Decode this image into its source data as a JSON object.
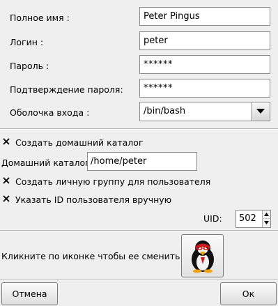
{
  "form": {
    "full_name": {
      "label": "Полное имя :",
      "value": "Peter Pingus"
    },
    "login": {
      "label": "Логин :",
      "value": "peter"
    },
    "password": {
      "label": "Пароль :",
      "value": "******"
    },
    "password_confirm": {
      "label": "Подтверждение пароля:",
      "value": "******"
    },
    "shell": {
      "label": "Оболочка входа :",
      "value": "/bin/bash"
    }
  },
  "options": {
    "create_home": {
      "label": "Создать домашний каталог",
      "checked": true
    },
    "home_dir": {
      "label": "Домашний каталог:",
      "value": "/home/peter"
    },
    "create_group": {
      "label": "Создать личную группу для пользователя",
      "checked": true
    },
    "manual_uid": {
      "label": "Указать ID пользователя вручную",
      "checked": true
    },
    "uid": {
      "label": "UID:",
      "value": "502"
    }
  },
  "icon_section": {
    "label": "Кликните по иконке чтобы ее сменить",
    "icon": "penguin-avatar-icon"
  },
  "buttons": {
    "cancel": "Отмена",
    "ok": "Ок"
  }
}
